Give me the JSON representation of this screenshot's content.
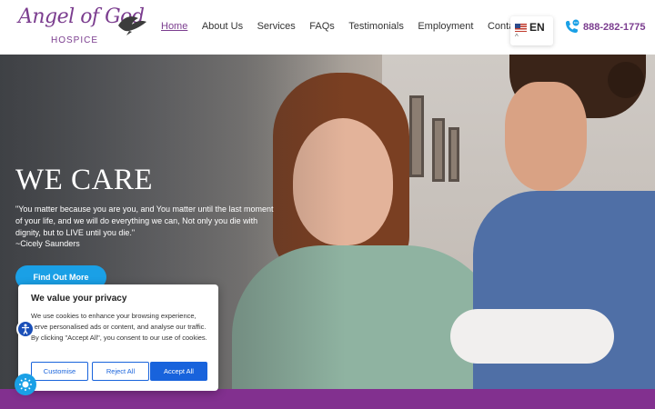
{
  "header": {
    "logo": {
      "script": "Angel of God",
      "sub": "HOSPICE"
    },
    "nav": [
      {
        "label": "Home",
        "active": true
      },
      {
        "label": "About Us"
      },
      {
        "label": "Services"
      },
      {
        "label": "FAQs"
      },
      {
        "label": "Testimonials"
      },
      {
        "label": "Employment"
      },
      {
        "label": "Contact Us"
      }
    ],
    "language": {
      "code": "EN",
      "flag_icon": "us-flag-icon",
      "caret": "^"
    },
    "phone": {
      "icon": "phone-chat-icon",
      "number": "888-282-1775"
    }
  },
  "hero": {
    "title": "WE CARE",
    "quote": "\"You matter because you are you, and You matter until the last moment of your life, and we will do everything we can, Not only you die with dignity, but to LIVE until you die.\"",
    "attribution": "~Cicely Saunders",
    "cta": "Find Out More"
  },
  "cookie": {
    "title": "We value your privacy",
    "body": "We use cookies to enhance your browsing experience, serve personalised ads or content, and analyse our traffic. By clicking \"Accept All\", you consent to our use of cookies.",
    "customise": "Customise",
    "reject": "Reject All",
    "accept": "Accept All"
  },
  "widgets": {
    "accessibility_icon": "accessibility-icon",
    "brightness_icon": "brightness-icon"
  },
  "colors": {
    "brand": "#7b3d8f",
    "accent": "#1aa0e6",
    "cookie_blue": "#1863dc",
    "band": "#82308f"
  }
}
